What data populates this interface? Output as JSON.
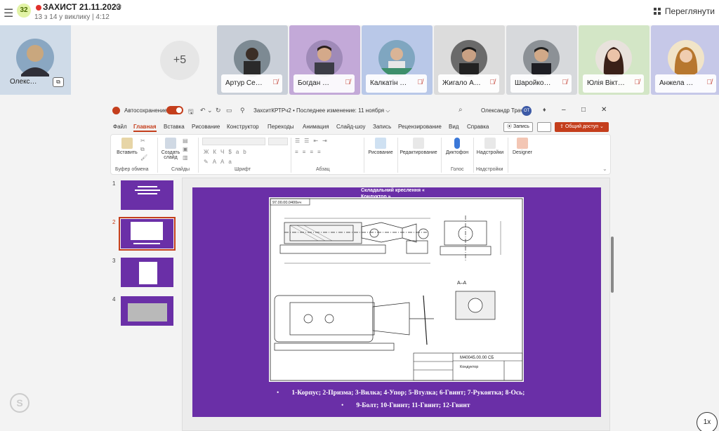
{
  "topbar": {
    "participant_count": "32",
    "title": "ЗАХИСТ 21.11.2023",
    "subtitle": "13 з 14 у виклику | 4:12",
    "view_label": "Переглянути"
  },
  "participants": {
    "self_name": "Олекс…",
    "overflow": "+5",
    "tiles": [
      {
        "name": "Артур Се…",
        "bg": "#c9cfd8"
      },
      {
        "name": "Богдан …",
        "bg": "#c3a9d8"
      },
      {
        "name": "Калкатін …",
        "bg": "#b9c8e8"
      },
      {
        "name": "Жигало А…",
        "bg": "#dcdcdc"
      },
      {
        "name": "Шаройко…",
        "bg": "#d7d9dc"
      },
      {
        "name": "Юлія Вікт…",
        "bg": "#d3e6c6"
      },
      {
        "name": "Анжела …",
        "bg": "#c6c8e8"
      }
    ]
  },
  "ppt": {
    "autosave": "Автосохранение",
    "doc_title": "ЗахситКРТРч2 • Последнее изменение: 11 ноября ⌵",
    "user": "Олександр Трач",
    "initials": "ОТ",
    "menu": [
      "Файл",
      "Главная",
      "Вставка",
      "Рисование",
      "Конструктор",
      "Переходы",
      "Анимация",
      "Слайд-шоу",
      "Запись",
      "Рецензирование",
      "Вид",
      "Справка"
    ],
    "record_btn": "⦿ Запись",
    "share_btn": "⇪ Общий доступ ⌄",
    "ribbon": {
      "paste": "Вставить",
      "create_slide": "Создать слайд",
      "drawing": "Рисование",
      "review": "Редактирование",
      "dictation": "Диктофон",
      "addins": "Надстройки",
      "designer": "Designer",
      "groups": [
        "Буфер обмена",
        "Слайды",
        "Шрифт",
        "Абзац",
        "Голос",
        "Надстройки"
      ]
    },
    "thumbs": [
      "1",
      "2",
      "3",
      "4"
    ],
    "slide": {
      "title_line1": "Складальний креслення «",
      "title_line2": "Кондуктор »",
      "caption1": "1-Корпус; 2-Призма; 3-Вилка; 4-Упор; 5-Втулка; 6-Гвинт; 7-Рукоятка; 8-Ось;",
      "caption2": "9-Болт; 10-Гвинт; 11-Гвинт; 12-Гвинт",
      "bullet": "•",
      "stamp": "М40045.00.00 СБ",
      "stamp_name": "Кондуктор",
      "doc_code": "97.00.00.0400нч",
      "section": "А–А"
    }
  },
  "speed": "1x",
  "colors": {
    "accent": "#c43e1c",
    "slide_bg": "#6a2fa7"
  }
}
